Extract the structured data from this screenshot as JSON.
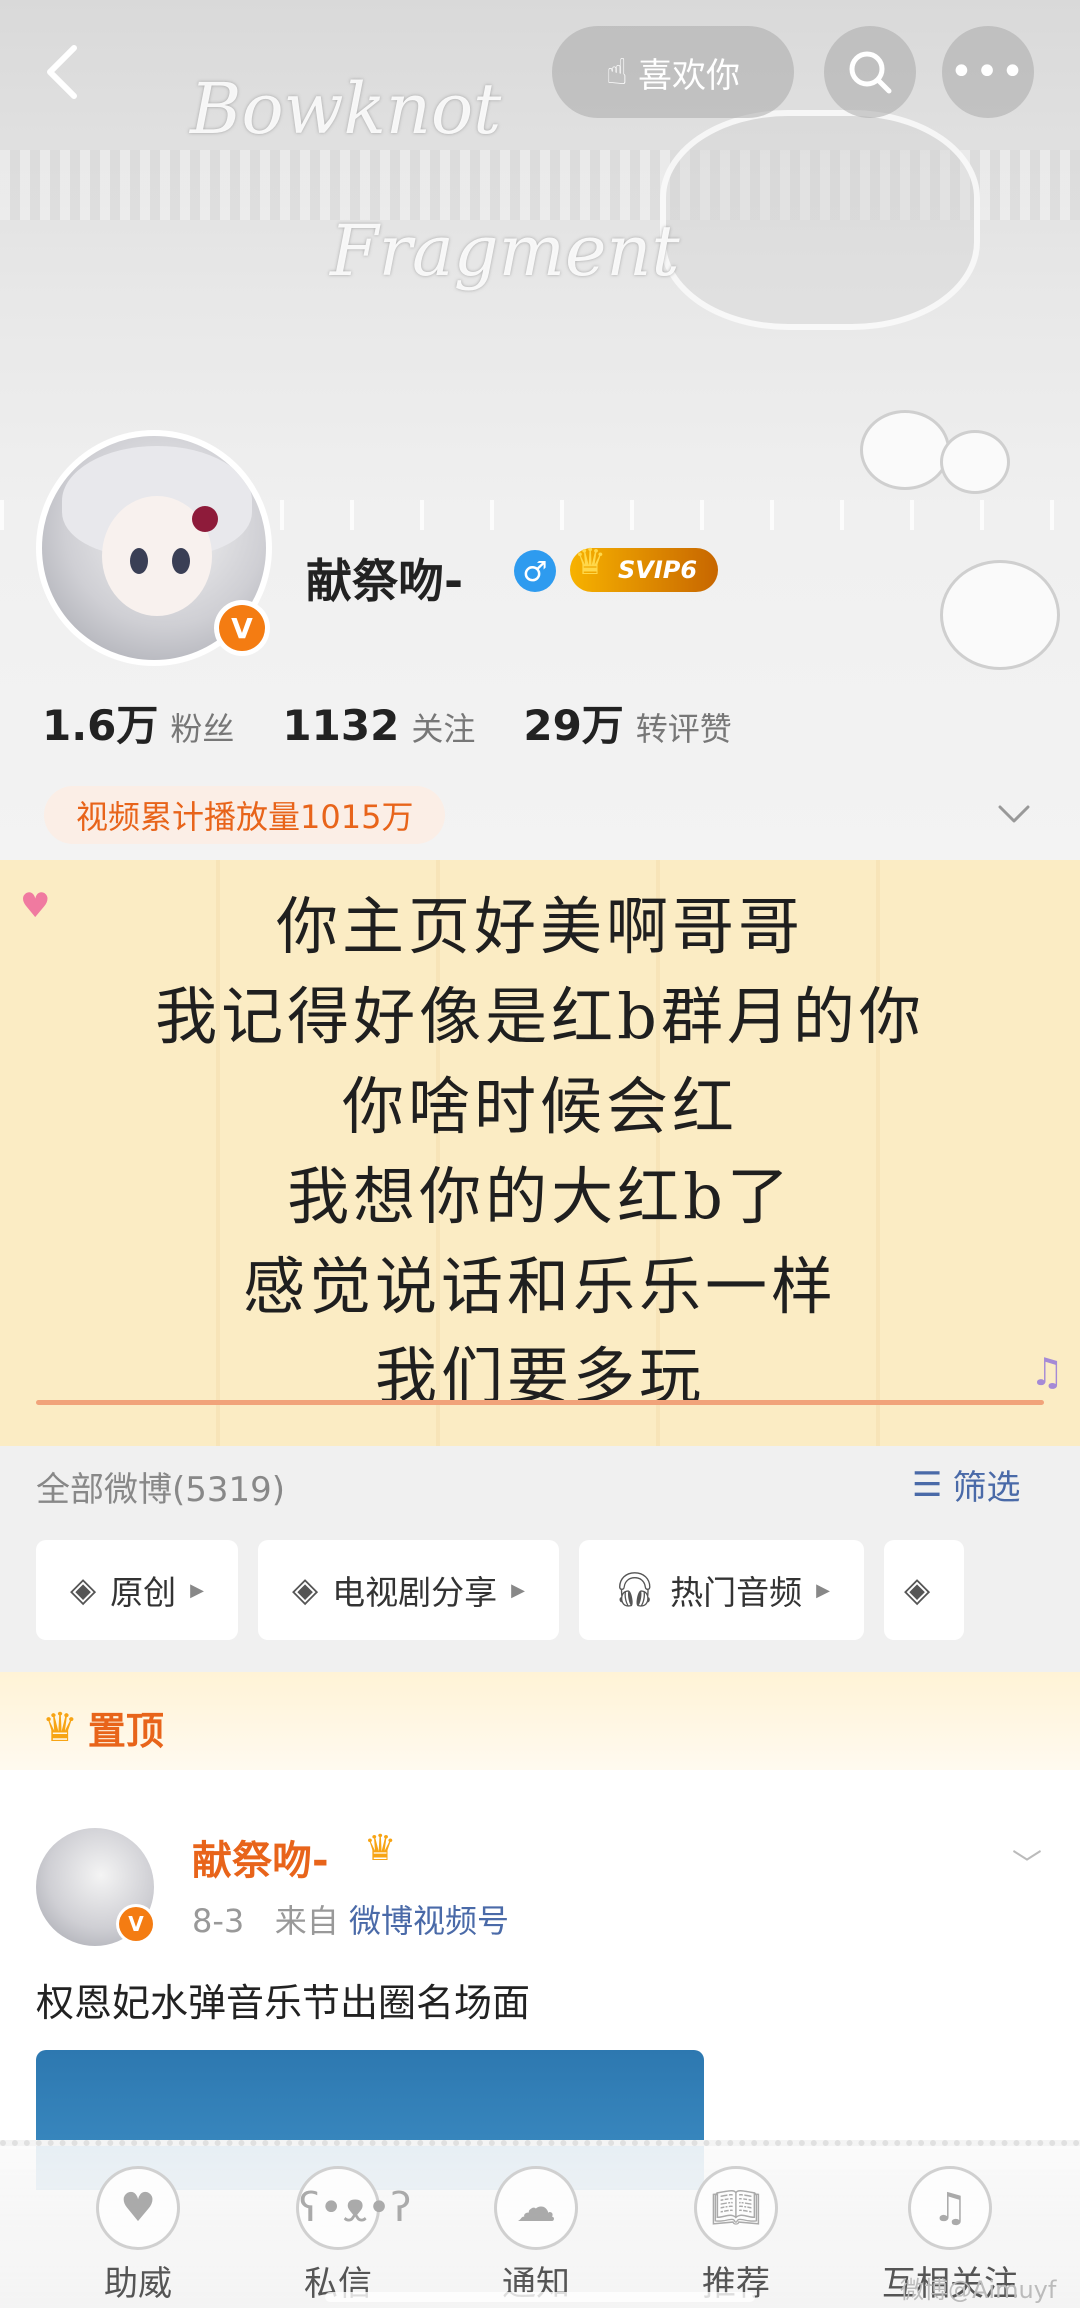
{
  "topbar": {
    "like_label": "喜欢你"
  },
  "banner": {
    "deco_line1": "Bowknot",
    "deco_line2": "Fragment"
  },
  "profile": {
    "username": "献祭吻-",
    "gender": "male",
    "vip_label": "SVIP6",
    "verified": "V"
  },
  "stats": [
    {
      "num": "1.6万",
      "label": "粉丝"
    },
    {
      "num": "1132",
      "label": "关注"
    },
    {
      "num": "29万",
      "label": "转评赞"
    }
  ],
  "video_play_count": "视频累计播放量1015万",
  "note": {
    "lines": [
      "你主页好美啊哥哥",
      "我记得好像是红b群月的你",
      "你啥时候会红",
      "我想你的大红b了",
      "感觉说话和乐乐一样",
      "我们要多玩"
    ]
  },
  "feed_header": {
    "all_weibo": "全部微博(5319)",
    "filter_label": "筛选"
  },
  "chips": [
    {
      "label": "原创",
      "icon": "layers-icon"
    },
    {
      "label": "电视剧分享",
      "icon": "layers-icon"
    },
    {
      "label": "热门音频",
      "icon": "headphones-icon"
    },
    {
      "label": "",
      "icon": "layers-icon"
    }
  ],
  "pinned": {
    "label": "置顶"
  },
  "post": {
    "author": "献祭吻-",
    "date": "8-3",
    "from_prefix": "来自",
    "source": "微博视频号",
    "text": "权恩妃水弹音乐节出圈名场面"
  },
  "tabbar": [
    {
      "label": "助威"
    },
    {
      "label": "私信"
    },
    {
      "label": "通知"
    },
    {
      "label": "推荐"
    },
    {
      "label": "互相关注"
    }
  ],
  "watermark": "微博@Aimuyf",
  "colors": {
    "accent_orange": "#e8641a",
    "link_blue": "#4a6aa8",
    "note_bg": "#fbecc4"
  }
}
